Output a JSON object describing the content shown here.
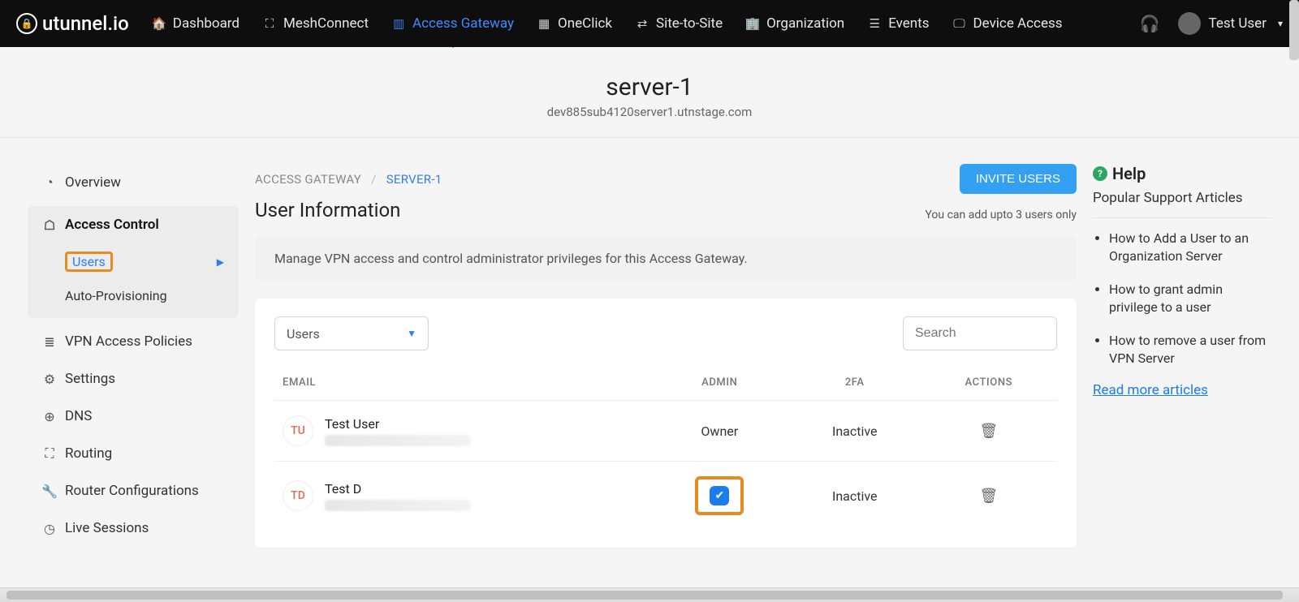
{
  "brand": "utunnel.io",
  "nav": [
    {
      "label": "Dashboard",
      "icon": "🏠"
    },
    {
      "label": "MeshConnect",
      "icon": "⛶"
    },
    {
      "label": "Access Gateway",
      "icon": "▥",
      "active": true
    },
    {
      "label": "OneClick",
      "icon": "▦"
    },
    {
      "label": "Site-to-Site",
      "icon": "⇄"
    },
    {
      "label": "Organization",
      "icon": "🏢"
    },
    {
      "label": "Events",
      "icon": "☰"
    },
    {
      "label": "Device Access",
      "icon": "🖵"
    }
  ],
  "user_menu": {
    "name": "Test User"
  },
  "server": {
    "name": "server-1",
    "host": "dev885sub4120server1.utnstage.com"
  },
  "sidebar": {
    "items": [
      {
        "label": "Overview",
        "icon": "◔"
      },
      {
        "label": "Access Control",
        "icon": "☖",
        "children": [
          {
            "label": "Users",
            "active": true,
            "highlight": true
          },
          {
            "label": "Auto-Provisioning"
          }
        ],
        "active_group": true
      },
      {
        "label": "VPN Access Policies",
        "icon": "≣"
      },
      {
        "label": "Settings",
        "icon": "⚙"
      },
      {
        "label": "DNS",
        "icon": "⊕"
      },
      {
        "label": "Routing",
        "icon": "⛶"
      },
      {
        "label": "Router Configurations",
        "icon": "🔧"
      },
      {
        "label": "Live Sessions",
        "icon": "◷"
      }
    ]
  },
  "breadcrumb": {
    "root": "ACCESS GATEWAY",
    "leaf": "SERVER-1"
  },
  "page": {
    "title": "User Information",
    "invite_btn": "INVITE USERS",
    "limit_note": "You can add upto 3 users only",
    "banner": "Manage VPN access and control administrator privileges for this Access Gateway.",
    "filter_selected": "Users",
    "search_placeholder": "Search",
    "columns": {
      "email": "EMAIL",
      "admin": "ADMIN",
      "twofa": "2FA",
      "actions": "ACTIONS"
    },
    "rows": [
      {
        "initials": "TU",
        "name": "Test User",
        "admin": "Owner",
        "twofa": "Inactive",
        "highlight_admin": false
      },
      {
        "initials": "TD",
        "name": "Test D",
        "admin": "checked",
        "twofa": "Inactive",
        "highlight_admin": true
      }
    ]
  },
  "help": {
    "heading": "Help",
    "subheading": "Popular Support Articles",
    "articles": [
      "How to Add a User to an Organization Server",
      "How to grant admin privilege to a user",
      "How to remove a user from VPN Server"
    ],
    "more": "Read more articles"
  }
}
